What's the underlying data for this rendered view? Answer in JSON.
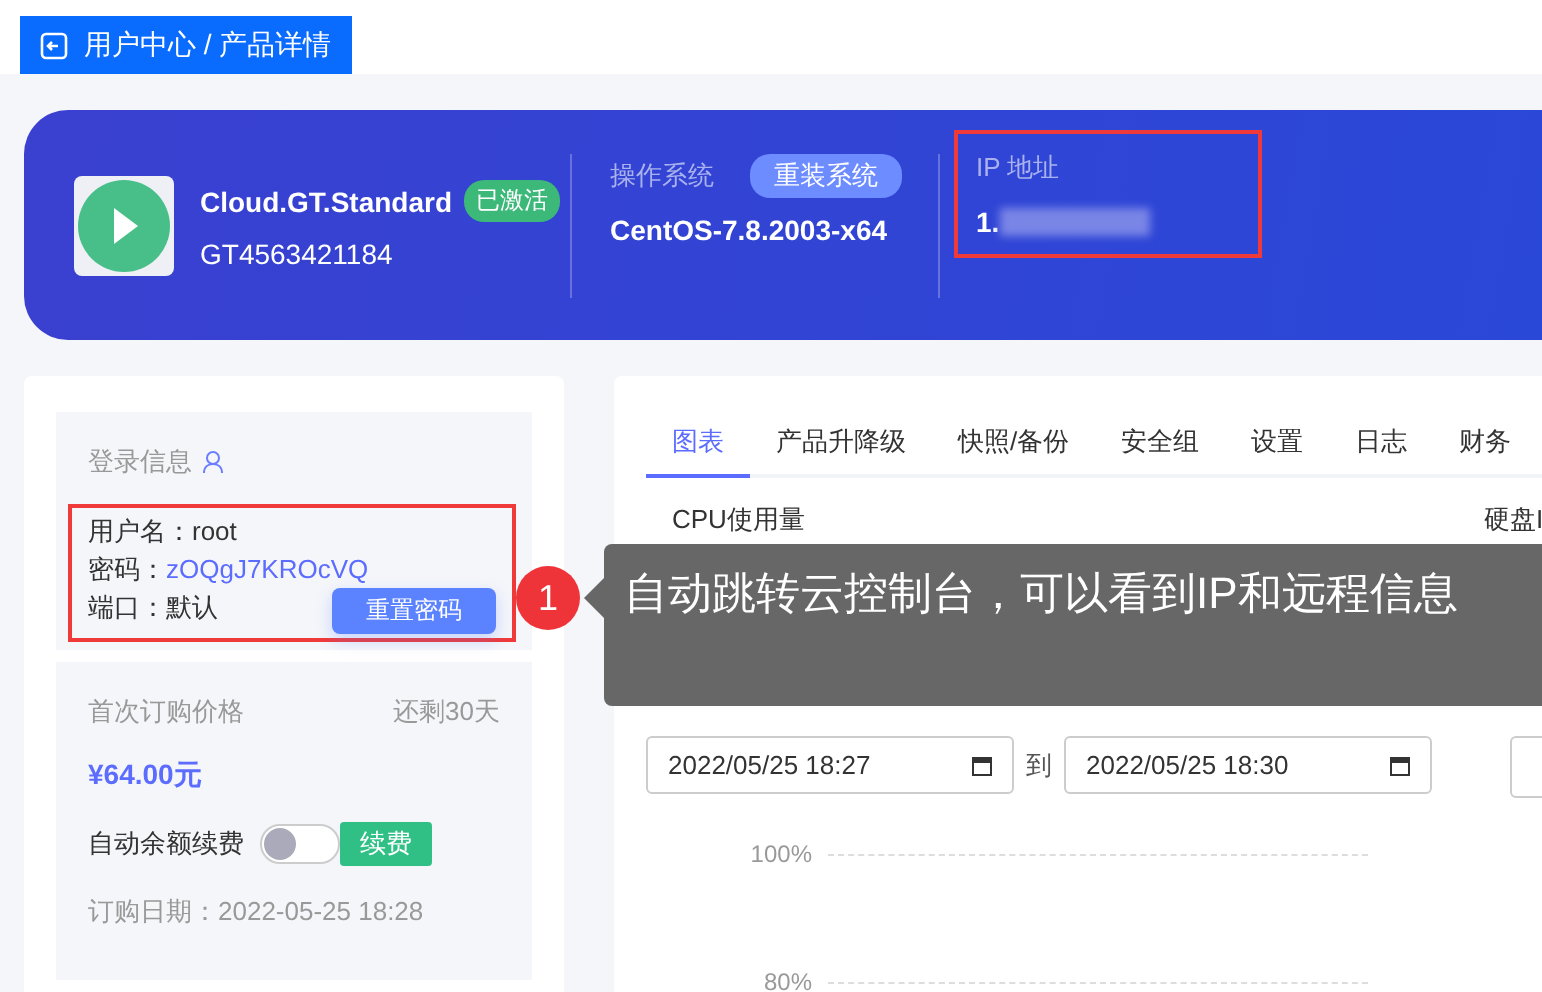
{
  "breadcrumb": {
    "label": "用户中心 / 产品详情"
  },
  "product": {
    "name": "Cloud.GT.Standard",
    "status": "已激活",
    "id": "GT4563421184"
  },
  "os": {
    "label": "操作系统",
    "button": "重装系统",
    "value": "CentOS-7.8.2003-x64"
  },
  "ip": {
    "label": "IP 地址",
    "value": "1.",
    "highlighted": true
  },
  "login": {
    "title": "登录信息",
    "highlighted": true,
    "lines": [
      {
        "label": "用户名：",
        "value": "root",
        "kind": "plain"
      },
      {
        "label": "密码：",
        "value": "zOQgJ7KROcVQ",
        "kind": "link"
      },
      {
        "label": "端口：",
        "value": "默认",
        "kind": "plain"
      }
    ],
    "button": "重置密码"
  },
  "billing": {
    "price_label": "首次订购价格",
    "remaining": "还剩30天",
    "price": "¥64.00元",
    "auto_renew_label": "自动余额续费",
    "auto_renew_on": false,
    "renew_button": "续费",
    "order_date": "订购日期：2022-05-25 18:28"
  },
  "tabs": [
    {
      "label": "图表",
      "selected": true
    },
    {
      "label": "产品升降级",
      "selected": false
    },
    {
      "label": "快照/备份",
      "selected": false
    },
    {
      "label": "安全组",
      "selected": false
    },
    {
      "label": "设置",
      "selected": false
    },
    {
      "label": "日志",
      "selected": false
    },
    {
      "label": "财务",
      "selected": false
    }
  ],
  "charts": [
    {
      "title": "CPU使用量",
      "start": "2022/05/25 18:27",
      "separator": "到",
      "end": "2022/05/25 18:30",
      "y_labels": [
        "100%",
        "80%"
      ]
    },
    {
      "title": "硬盘I"
    }
  ],
  "callout": {
    "number": "1",
    "text": "自动跳转云控制台，可以看到IP和远程信息"
  }
}
